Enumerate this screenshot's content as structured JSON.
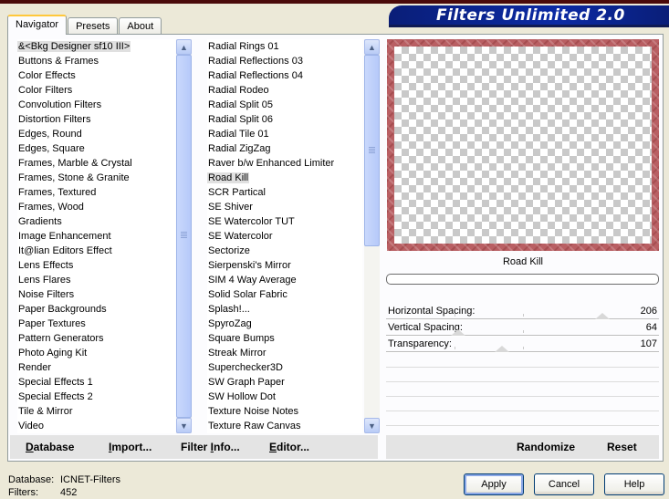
{
  "banner": {
    "title": "Filters Unlimited 2.0"
  },
  "tabs": [
    "Navigator",
    "Presets",
    "About"
  ],
  "categories": {
    "items": [
      "&<Bkg Designer sf10 III>",
      "Buttons & Frames",
      "Color Effects",
      "Color Filters",
      "Convolution Filters",
      "Distortion Filters",
      "Edges, Round",
      "Edges, Square",
      "Frames, Marble & Crystal",
      "Frames, Stone & Granite",
      "Frames, Textured",
      "Frames, Wood",
      "Gradients",
      "Image Enhancement",
      "It@lian Editors Effect",
      "Lens Effects",
      "Lens Flares",
      "Noise Filters",
      "Paper Backgrounds",
      "Paper Textures",
      "Pattern Generators",
      "Photo Aging Kit",
      "Render",
      "Special Effects 1",
      "Special Effects 2",
      "Tile & Mirror",
      "Video"
    ],
    "selected_index": 0
  },
  "filters": {
    "items": [
      "Radial  Rings 01",
      "Radial Reflections 03",
      "Radial Reflections 04",
      "Radial Rodeo",
      "Radial Split 05",
      "Radial Split 06",
      "Radial Tile 01",
      "Radial ZigZag",
      "Raver b/w Enhanced Limiter",
      "Road Kill",
      "SCR  Partical",
      "SE Shiver",
      "SE Watercolor TUT",
      "SE Watercolor",
      "Sectorize",
      "Sierpenski's Mirror",
      "SIM 4 Way Average",
      "Solid Solar Fabric",
      "Splash!...",
      "SpyroZag",
      "Square Bumps",
      "Streak Mirror",
      "Superchecker3D",
      "SW Graph Paper",
      "SW Hollow Dot",
      "Texture Noise Notes",
      "Texture Raw Canvas"
    ],
    "selected_index": 9
  },
  "bottom_actions": {
    "database": {
      "key": "D",
      "rest": "atabase"
    },
    "import": {
      "key": "I",
      "rest": "mport..."
    },
    "filter_info": {
      "pre": "Filter ",
      "key": "I",
      "rest": "nfo..."
    },
    "editor": {
      "key": "E",
      "rest": "ditor..."
    }
  },
  "preview": {
    "filter_name": "Road Kill"
  },
  "parameters": [
    {
      "label": "Horizontal Spacing:",
      "value": 206,
      "max": 255
    },
    {
      "label": "Vertical Spacing:",
      "value": 64,
      "max": 255
    },
    {
      "label": "Transparency:",
      "value": 107,
      "max": 255
    }
  ],
  "right_actions": {
    "randomize": "Randomize",
    "reset": "Reset"
  },
  "status": {
    "database_label": "Database:",
    "database_value": "ICNET-Filters",
    "filters_label": "Filters:",
    "filters_value": "452"
  },
  "buttons": {
    "apply": "Apply",
    "cancel": "Cancel",
    "help": "Help"
  },
  "colors": {
    "banner": "#0b2aa4",
    "frame": "#b95f63",
    "tab_highlight": "#ffc83c"
  }
}
